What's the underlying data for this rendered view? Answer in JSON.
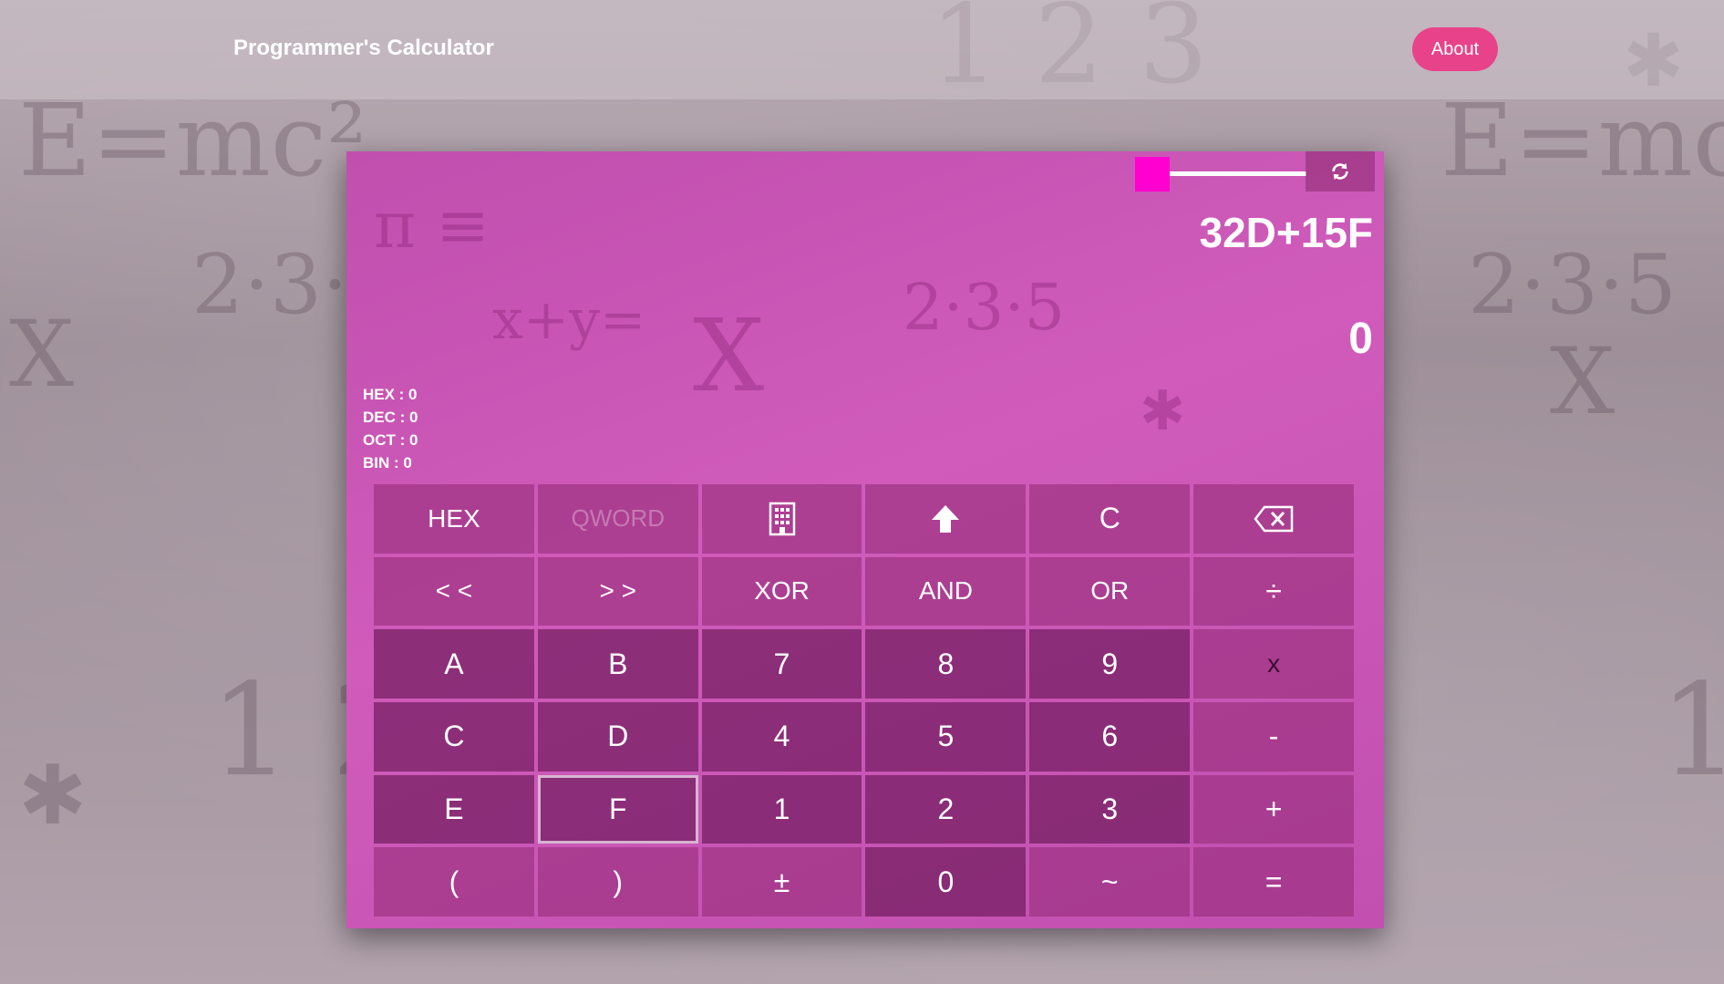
{
  "navbar": {
    "brand": "Programmer's Calculator",
    "about_label": "About"
  },
  "colors": {
    "accent": "#e8438a",
    "calculator_bg": "#c853b5",
    "slider_thumb": "#ff00d0"
  },
  "display": {
    "expression": "32D+15F",
    "result": "0",
    "bases": {
      "hex": "HEX : 0",
      "dec": "DEC : 0",
      "oct": "OCT : 0",
      "bin": "BIN : 0"
    }
  },
  "icons": {
    "refresh": "refresh-icon",
    "memory": "building-icon",
    "shift": "arrow-up-icon",
    "backspace": "backspace-icon"
  },
  "keys": {
    "hex": "HEX",
    "qword": "QWORD",
    "clear": "C",
    "lshift": "< <",
    "rshift": "> >",
    "xor": "XOR",
    "and": "AND",
    "or": "OR",
    "divide": "÷",
    "a": "A",
    "b": "B",
    "seven": "7",
    "eight": "8",
    "nine": "9",
    "multiply": "x",
    "c": "C",
    "d": "D",
    "four": "4",
    "five": "5",
    "six": "6",
    "minus": "-",
    "e": "E",
    "f": "F",
    "one": "1",
    "two": "2",
    "three": "3",
    "plus": "+",
    "lparen": "(",
    "rparen": ")",
    "plusminus": "±",
    "zero": "0",
    "not": "~",
    "equals": "="
  }
}
